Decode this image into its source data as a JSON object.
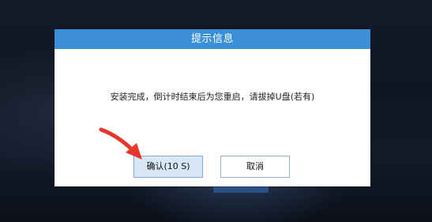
{
  "dialog": {
    "title": "提示信息",
    "message": "安装完成，倒计时结束后为您重启，请拔掉U盘(若有)",
    "confirm_label": "确认(10 S)",
    "cancel_label": "取消"
  },
  "colors": {
    "titlebar": "#3b8fd6",
    "confirm_bg": "#d9e8f6",
    "arrow": "#e8362a"
  },
  "icons": {
    "pointer": "red-arrow-icon"
  }
}
